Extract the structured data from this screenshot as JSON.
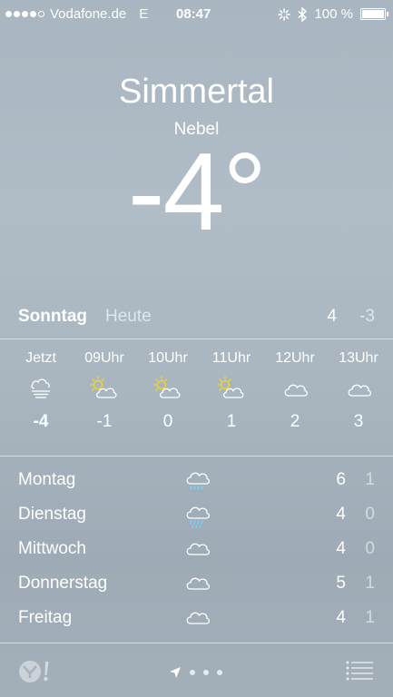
{
  "status_bar": {
    "carrier": "Vodafone.de",
    "network": "E",
    "time": "08:47",
    "battery": "100 %",
    "signal_bars": 4,
    "signal_total": 5
  },
  "weather": {
    "city": "Simmertal",
    "condition": "Nebel",
    "temperature": "-4°"
  },
  "today": {
    "day": "Sonntag",
    "label": "Heute",
    "high": "4",
    "low": "-3"
  },
  "hourly": [
    {
      "time": "Jetzt",
      "icon": "fog-icon",
      "temp": "-4"
    },
    {
      "time": "09Uhr",
      "icon": "partly-sunny-icon",
      "temp": "-1"
    },
    {
      "time": "10Uhr",
      "icon": "partly-sunny-icon",
      "temp": "0"
    },
    {
      "time": "11Uhr",
      "icon": "partly-sunny-icon",
      "temp": "1"
    },
    {
      "time": "12Uhr",
      "icon": "cloud-icon",
      "temp": "2"
    },
    {
      "time": "13Uhr",
      "icon": "cloud-icon",
      "temp": "3"
    }
  ],
  "daily": [
    {
      "day": "Montag",
      "icon": "rain-cloud-icon",
      "high": "6",
      "low": "1"
    },
    {
      "day": "Dienstag",
      "icon": "rain-cloud-icon",
      "high": "4",
      "low": "0"
    },
    {
      "day": "Mittwoch",
      "icon": "cloud-icon",
      "high": "4",
      "low": "0"
    },
    {
      "day": "Donnerstag",
      "icon": "cloud-icon",
      "high": "5",
      "low": "1"
    },
    {
      "day": "Freitag",
      "icon": "cloud-icon",
      "high": "4",
      "low": "1"
    }
  ],
  "footer": {
    "logo": "yahoo-logo",
    "page_indicators": 3,
    "menu_icon": "list-icon"
  },
  "colors": {
    "sun": "#f2d22e",
    "rain": "#7fd1ff",
    "text": "#ffffff"
  }
}
